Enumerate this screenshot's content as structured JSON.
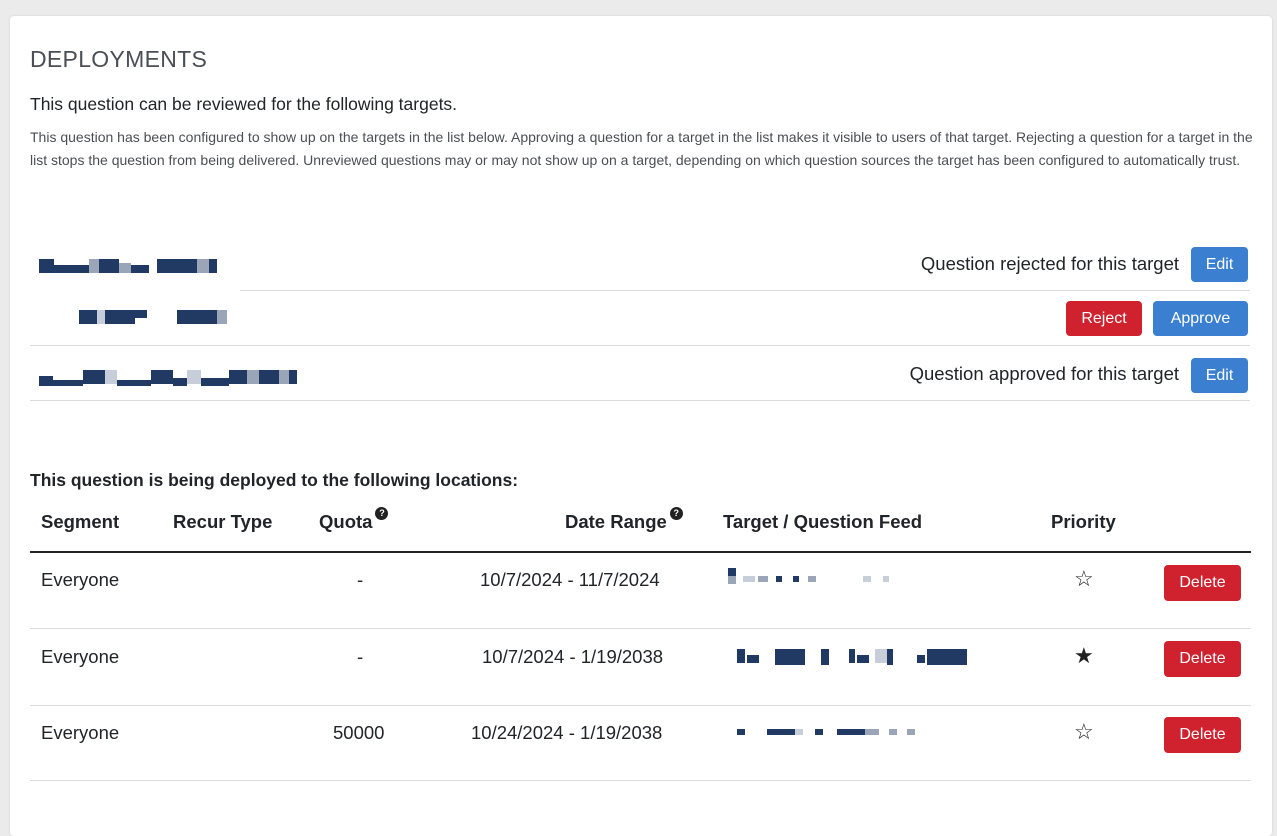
{
  "section": {
    "title": "DEPLOYMENTS",
    "subtitle": "This question can be reviewed for the following targets.",
    "description": "This question has been configured to show up on the targets in the list below. Approving a question for a target in the list makes it visible to users of that target. Rejecting a question for a target in the list stops the question from being delivered. Unreviewed questions may or may not show up on a target, depending on which question sources the target has been configured to automatically trust."
  },
  "targets": [
    {
      "status": "Question rejected for this target",
      "edit_label": "Edit"
    },
    {
      "reject_label": "Reject",
      "approve_label": "Approve"
    },
    {
      "status": "Question approved for this target",
      "edit_label": "Edit"
    }
  ],
  "deployments": {
    "heading": "This question is being deployed to the following locations:",
    "columns": {
      "segment": "Segment",
      "recur_type": "Recur Type",
      "quota": "Quota",
      "date_range": "Date Range",
      "target_feed": "Target / Question Feed",
      "priority": "Priority"
    },
    "help_icon_glyph": "?",
    "rows": [
      {
        "segment": "Everyone",
        "recur_type": "",
        "quota": "-",
        "date_range": "10/7/2024 - 11/7/2024",
        "priority_starred": false,
        "priority_glyph": "☆",
        "delete_label": "Delete"
      },
      {
        "segment": "Everyone",
        "recur_type": "",
        "quota": "-",
        "date_range": "10/7/2024 - 1/19/2038",
        "priority_starred": true,
        "priority_glyph": "★",
        "delete_label": "Delete"
      },
      {
        "segment": "Everyone",
        "recur_type": "",
        "quota": "50000",
        "date_range": "10/24/2024 - 1/19/2038",
        "priority_starred": false,
        "priority_glyph": "☆",
        "delete_label": "Delete"
      }
    ]
  },
  "colors": {
    "primary": "#3a7fd0",
    "danger": "#d0212f",
    "redacted": "#203a63"
  }
}
